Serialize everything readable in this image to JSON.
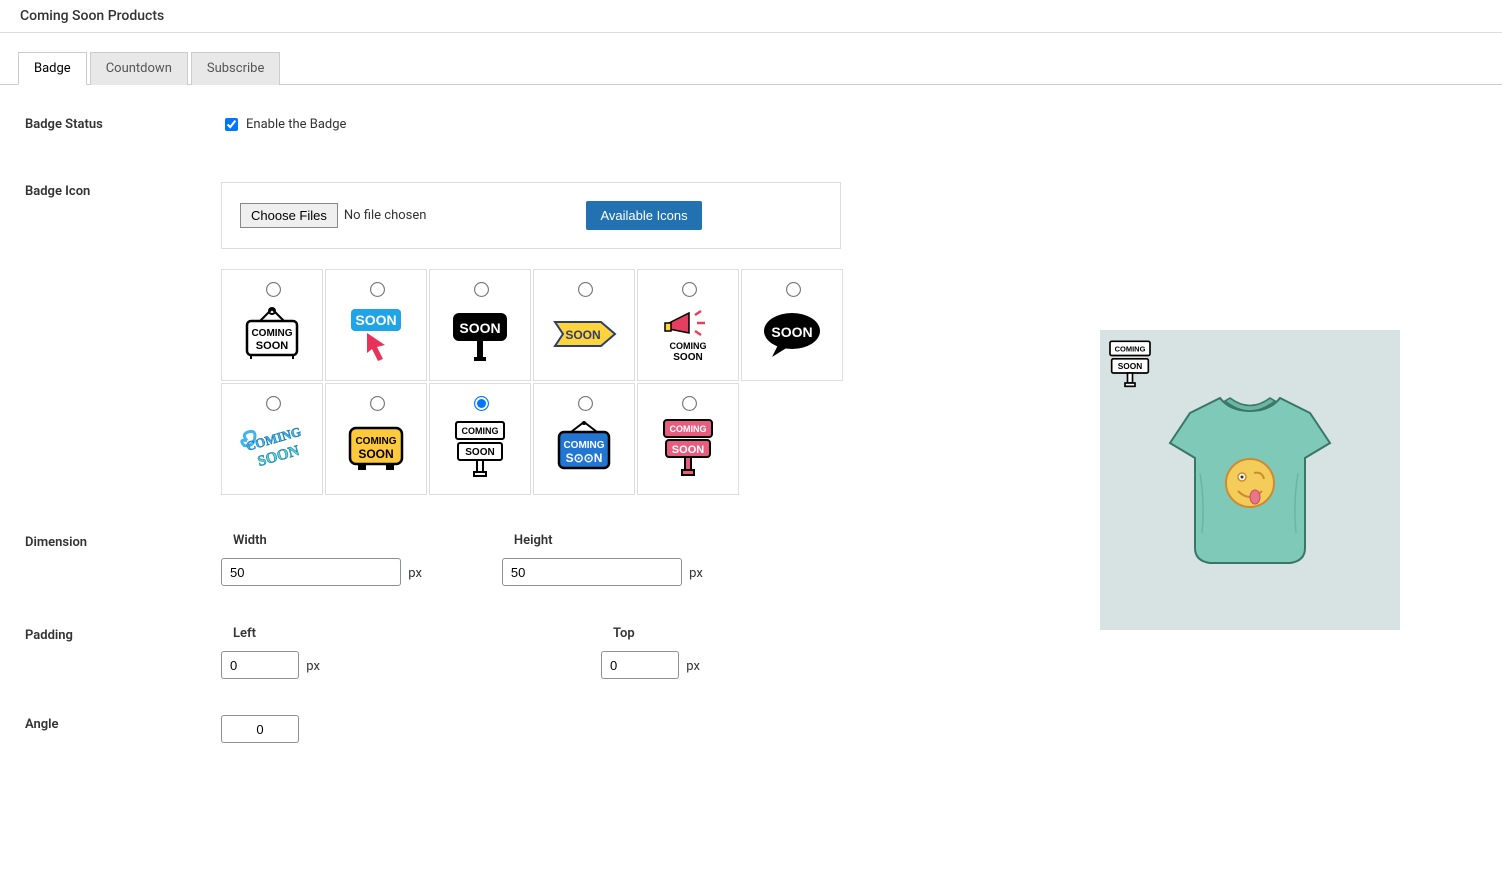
{
  "header": {
    "title": "Coming Soon Products"
  },
  "tabs": [
    {
      "label": "Badge",
      "active": true
    },
    {
      "label": "Countdown",
      "active": false
    },
    {
      "label": "Subscribe",
      "active": false
    }
  ],
  "form": {
    "badge_status": {
      "label": "Badge Status",
      "checkbox_label": "Enable the Badge",
      "checked": true
    },
    "badge_icon": {
      "label": "Badge Icon",
      "choose_label": "Choose Files",
      "file_status": "No file chosen",
      "available_label": "Available Icons",
      "selected_index": 8
    },
    "dimension": {
      "label": "Dimension",
      "width_label": "Width",
      "width_value": "50",
      "width_unit": "px",
      "height_label": "Height",
      "height_value": "50",
      "height_unit": "px"
    },
    "padding": {
      "label": "Padding",
      "left_label": "Left",
      "left_value": "0",
      "left_unit": "px",
      "top_label": "Top",
      "top_value": "0",
      "top_unit": "px"
    },
    "angle": {
      "label": "Angle",
      "value": "0"
    }
  },
  "icons": [
    {
      "name": "coming-soon-sign"
    },
    {
      "name": "soon-cursor-arrow"
    },
    {
      "name": "soon-black-sign"
    },
    {
      "name": "soon-yellow-arrow"
    },
    {
      "name": "coming-soon-megaphone"
    },
    {
      "name": "soon-black-bubble"
    },
    {
      "name": "coming-soon-neon"
    },
    {
      "name": "coming-soon-yellow"
    },
    {
      "name": "coming-soon-outline-sign"
    },
    {
      "name": "coming-soon-blue"
    },
    {
      "name": "coming-soon-pink"
    }
  ]
}
